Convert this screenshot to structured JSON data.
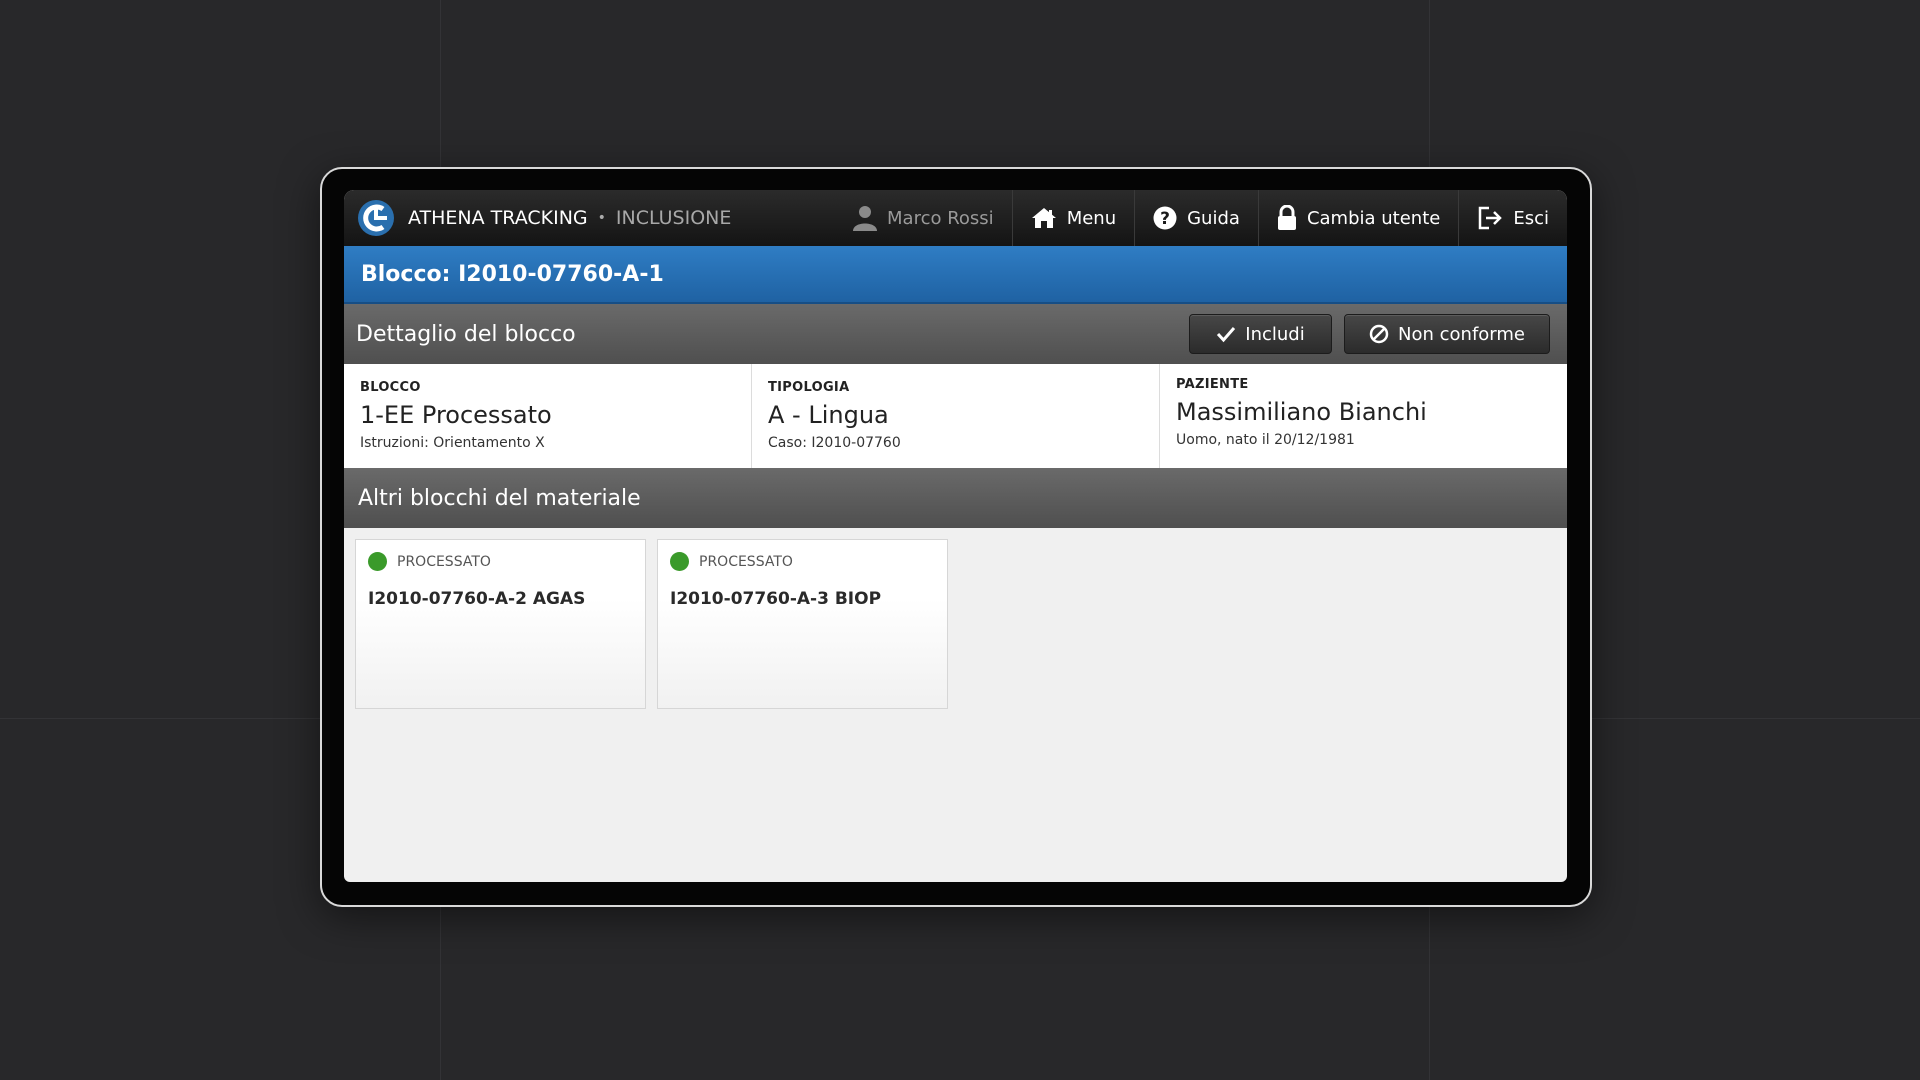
{
  "app": {
    "name": "ATHENA TRACKING",
    "section": "INCLUSIONE",
    "logo_icon": "athena-logo-icon"
  },
  "nav": {
    "user_name": "Marco Rossi",
    "menu_label": "Menu",
    "help_label": "Guida",
    "switch_user_label": "Cambia utente",
    "exit_label": "Esci"
  },
  "title": "Blocco: I2010-07760-A-1",
  "detail_section": {
    "title": "Dettaglio del blocco",
    "include_label": "Includi",
    "nonconform_label": "Non conforme"
  },
  "details": {
    "block": {
      "label": "BLOCCO",
      "value": "1-EE Processato",
      "sub": "Istruzioni: Orientamento X"
    },
    "type": {
      "label": "TIPOLOGIA",
      "value": "A - Lingua",
      "sub": "Caso: I2010-07760"
    },
    "patient": {
      "label": "PAZIENTE",
      "value": "Massimiliano Bianchi",
      "sub": "Uomo, nato il 20/12/1981"
    }
  },
  "other_section": {
    "title": "Altri blocchi del materiale"
  },
  "blocks": [
    {
      "status": "PROCESSATO",
      "name": "I2010-07760-A-2 AGAS",
      "status_color": "#3a9a2a"
    },
    {
      "status": "PROCESSATO",
      "name": "I2010-07760-A-3 BIOP",
      "status_color": "#3a9a2a"
    }
  ],
  "colors": {
    "title_bar": "#2a73b9",
    "status_processed": "#3a9a2a"
  }
}
